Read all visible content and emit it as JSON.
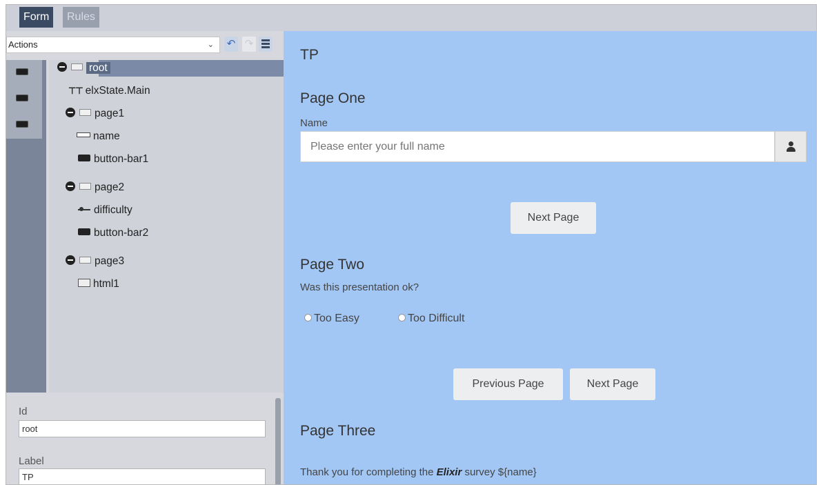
{
  "tabs": {
    "form": "Form",
    "rules": "Rules"
  },
  "toolbar": {
    "actions_label": "Actions",
    "undo_icon": "undo-icon",
    "redo_icon": "redo-icon",
    "menu_icon": "hamburger-menu-icon"
  },
  "tree": {
    "root": "root",
    "state": "elxState.Main",
    "page1": "page1",
    "name": "name",
    "button_bar1": "button-bar1",
    "page2": "page2",
    "difficulty": "difficulty",
    "button_bar2": "button-bar2",
    "page3": "page3",
    "html1": "html1"
  },
  "properties": {
    "id_label": "Id",
    "id_value": "root",
    "label_label": "Label",
    "label_value": "TP"
  },
  "preview": {
    "title": "TP",
    "page_one": {
      "heading": "Page One",
      "name_label": "Name",
      "name_placeholder": "Please enter your full name",
      "next_button": "Next Page"
    },
    "page_two": {
      "heading": "Page Two",
      "question": "Was this presentation ok?",
      "option_easy": "Too Easy",
      "option_difficult": "Too Difficult",
      "previous_button": "Previous Page",
      "next_button": "Next Page"
    },
    "page_three": {
      "heading": "Page Three",
      "text_before": "Thank you for completing the ",
      "text_emphasis": "Elixir",
      "text_after": " survey ${name}"
    }
  },
  "colors": {
    "preview_background": "#a3c7f5",
    "selected_tab": "#3b4a63",
    "tree_selection": "#5a6984"
  }
}
